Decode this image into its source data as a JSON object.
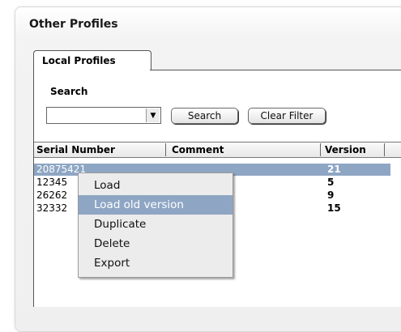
{
  "panel": {
    "title": "Other Profiles"
  },
  "tabs": [
    {
      "label": "Local Profiles"
    }
  ],
  "search": {
    "label": "Search",
    "combo_value": "",
    "search_button": "Search",
    "clear_button": "Clear Filter"
  },
  "table": {
    "columns": [
      "Serial Number",
      "Comment",
      "Version"
    ],
    "rows": [
      {
        "serial": "20875421",
        "comment": "",
        "version": "21"
      },
      {
        "serial": "12345",
        "comment": "",
        "version": "5"
      },
      {
        "serial": "26262",
        "comment": "",
        "version": "9"
      },
      {
        "serial": "32332",
        "comment": "",
        "version": "15"
      }
    ],
    "selected_row": 0
  },
  "context_menu": {
    "items": [
      "Load",
      "Load old version",
      "Duplicate",
      "Delete",
      "Export"
    ],
    "highlighted": 1
  },
  "colors": {
    "selection": "#8ea6c4",
    "menu_bg": "#ececec"
  },
  "icons": {
    "combo_arrow": "chevron-down-icon"
  }
}
